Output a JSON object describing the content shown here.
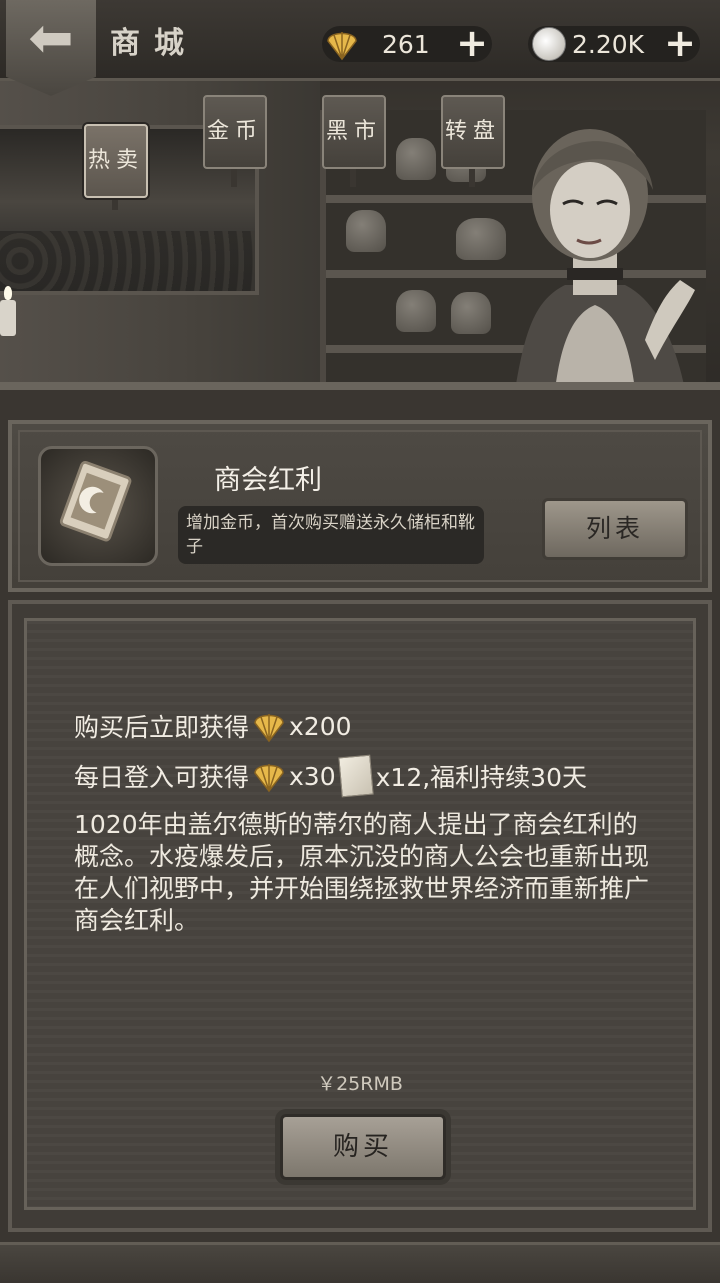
{
  "topbar": {
    "title": "商城",
    "shells": "261",
    "coins": "2.20K"
  },
  "tabs": [
    {
      "label": "热卖",
      "active": true
    },
    {
      "label": "金币",
      "active": false
    },
    {
      "label": "黑市",
      "active": false
    },
    {
      "label": "转盘",
      "active": false
    }
  ],
  "promo": {
    "title": "商会红利",
    "description": "增加金币，首次购买赠送永久储柜和靴子",
    "list_button": "列表"
  },
  "details": {
    "line1_text": "购买后立即获得",
    "line1_amount": "x200",
    "line2_text": "每日登入可获得",
    "line2_shells": "x30",
    "line2_paper": "x12,福利持续30天",
    "lore": "1020年由盖尔德斯的蒂尔的商人提出了商会红利的概念。水疫爆发后，原本沉没的商人公会也重新出现在人们视野中，并开始围绕拯救世界经济而重新推广商会红利。",
    "price": "￥25RMB",
    "buy_button": "购买"
  },
  "colors": {
    "shell_gold": "#e6b84a",
    "panel_bg": "#47433e",
    "button_face": "#9e978b"
  }
}
